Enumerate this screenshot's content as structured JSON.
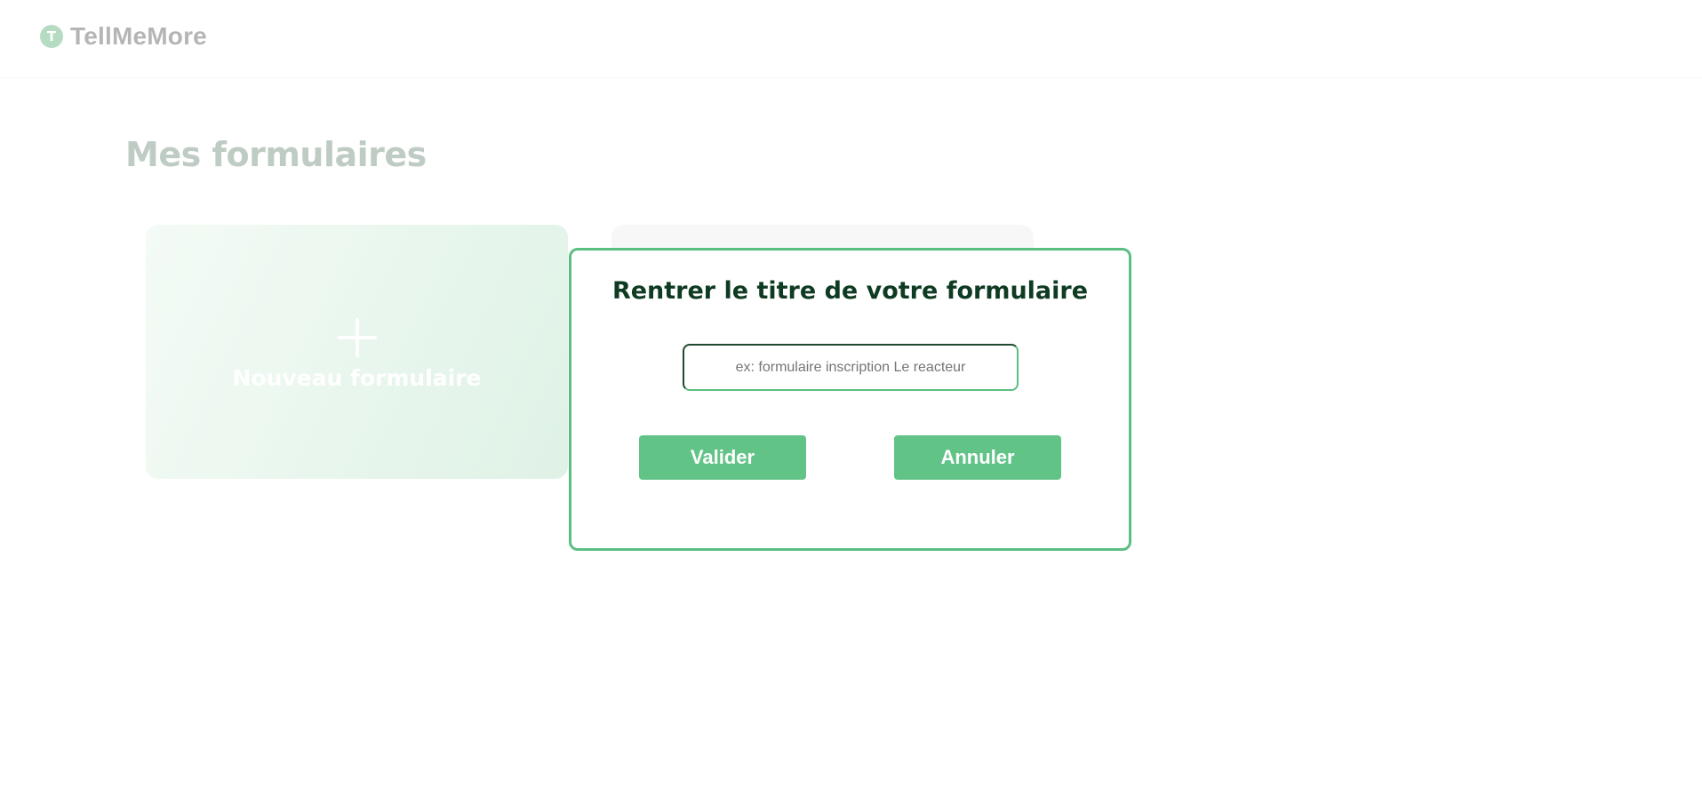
{
  "header": {
    "logo_letter": "T",
    "app_name": "TellMeMore"
  },
  "main": {
    "page_title": "Mes formulaires",
    "new_form_card": {
      "icon": "plus-icon",
      "label": "Nouveau formulaire"
    }
  },
  "modal": {
    "title": "Rentrer le titre de votre formulaire",
    "input": {
      "value": "",
      "placeholder": "ex: formulaire inscription Le reacteur"
    },
    "validate_label": "Valider",
    "cancel_label": "Annuler"
  },
  "colors": {
    "accent": "#62c387",
    "modal_border": "#5cbf82",
    "modal_title": "#0e3b22",
    "logo_mark": "#2f9a57"
  }
}
